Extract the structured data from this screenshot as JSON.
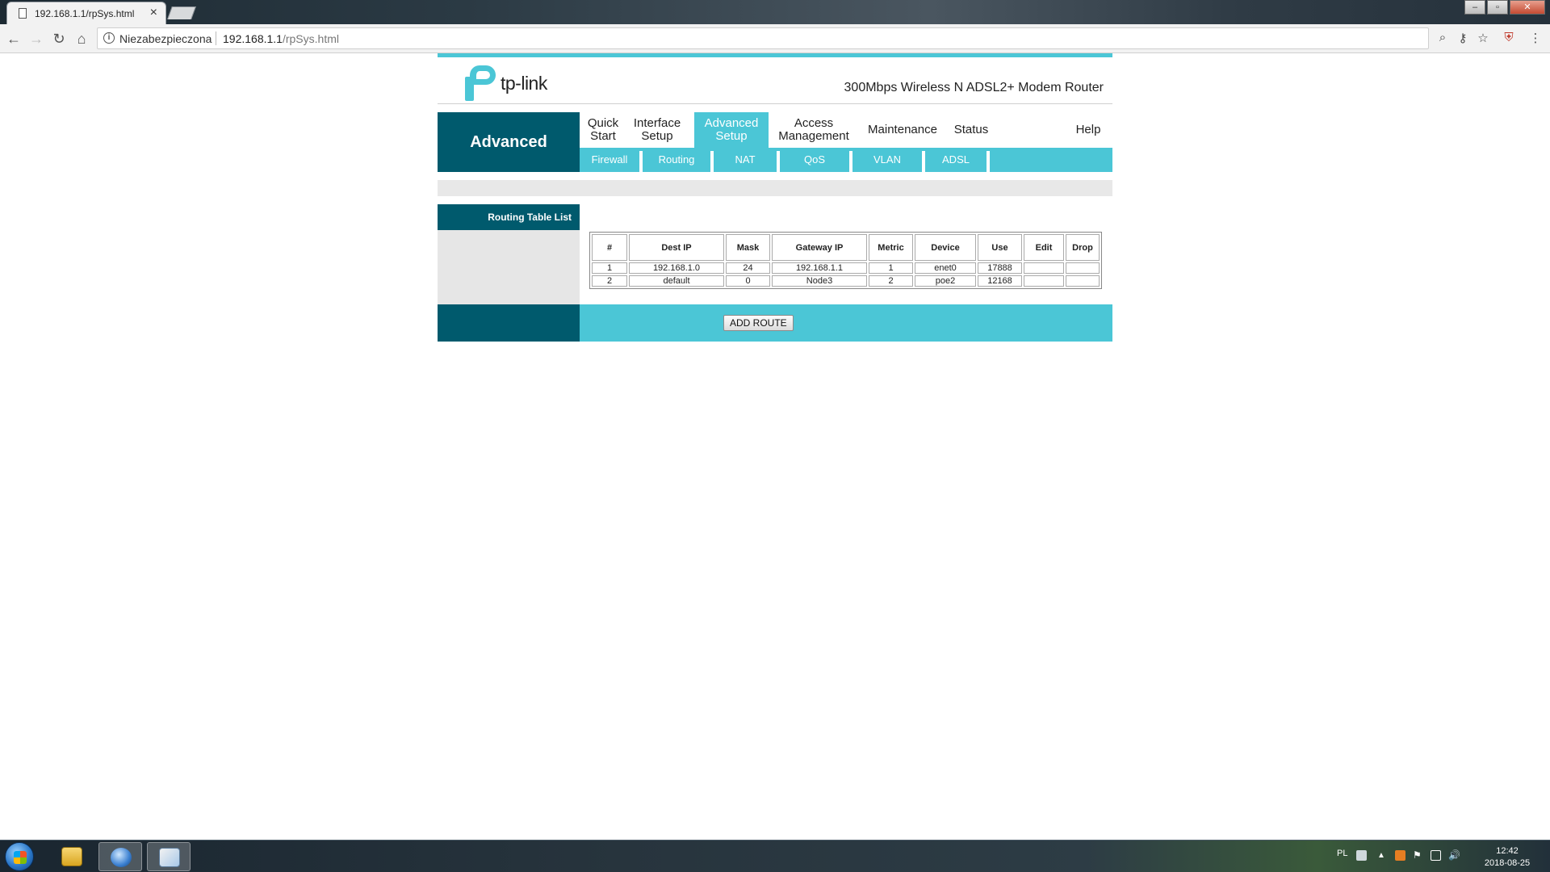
{
  "browser": {
    "tab_title": "192.168.1.1/rpSys.html",
    "security_label": "Niezabezpieczona",
    "url_host": "192.168.1.1",
    "url_path": "/rpSys.html"
  },
  "router": {
    "logo_text": "tp-link",
    "product_name": "300Mbps Wireless N ADSL2+ Modem Router",
    "section_title": "Advanced",
    "main_menu": [
      {
        "label": "Quick\nStart"
      },
      {
        "label": "Interface\nSetup"
      },
      {
        "label": "Advanced\nSetup",
        "active": true
      },
      {
        "label": "Access\nManagement"
      },
      {
        "label": "Maintenance"
      },
      {
        "label": "Status"
      },
      {
        "label": "Help"
      }
    ],
    "sub_menu": [
      "Firewall",
      "Routing",
      "NAT",
      "QoS",
      "VLAN",
      "ADSL"
    ],
    "panel_label": "Routing Table List",
    "table": {
      "headers": [
        "#",
        "Dest IP",
        "Mask",
        "Gateway IP",
        "Metric",
        "Device",
        "Use",
        "Edit",
        "Drop"
      ],
      "rows": [
        [
          "1",
          "192.168.1.0",
          "24",
          "192.168.1.1",
          "1",
          "enet0",
          "17888",
          "",
          ""
        ],
        [
          "2",
          "default",
          "0",
          "Node3",
          "2",
          "poe2",
          "12168",
          "",
          ""
        ]
      ]
    },
    "add_route_label": "ADD ROUTE",
    "colors": {
      "accent": "#4bc6d6",
      "dark": "#005a6d",
      "gray": "#e6e6e6"
    }
  },
  "taskbar": {
    "language": "PL",
    "time": "12:42",
    "date": "2018-08-25"
  }
}
